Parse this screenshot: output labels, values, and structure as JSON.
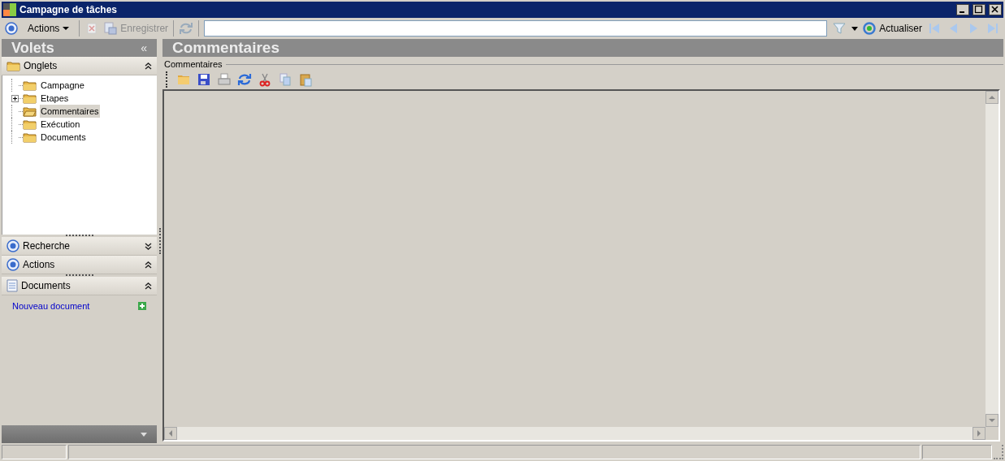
{
  "window": {
    "title": "Campagne de tâches"
  },
  "toolbar": {
    "actions_menu": "Actions",
    "save": {
      "label": "Enregistrer",
      "disabled": true
    },
    "refresh": "Actualiser"
  },
  "sidebar": {
    "title": "Volets",
    "collapse": "«",
    "sections": [
      {
        "title": "Onglets",
        "kind": "tree",
        "expanded": true,
        "tree": [
          {
            "label": "Campagne",
            "kind": "leaf",
            "selected": false
          },
          {
            "label": "Etapes",
            "kind": "branch",
            "selected": false
          },
          {
            "label": "Commentaires",
            "kind": "leaf",
            "selected": true
          },
          {
            "label": "Exécution",
            "kind": "leaf",
            "selected": false
          },
          {
            "label": "Documents",
            "kind": "leaf",
            "selected": false
          }
        ]
      },
      {
        "title": "Recherche",
        "kind": "search",
        "expanded": false
      },
      {
        "title": "Actions",
        "kind": "actions",
        "expanded": true
      },
      {
        "title": "Documents",
        "kind": "documents",
        "expanded": true,
        "links": [
          "Nouveau document"
        ]
      }
    ]
  },
  "content": {
    "title": "Commentaires",
    "group": "Commentaires"
  }
}
